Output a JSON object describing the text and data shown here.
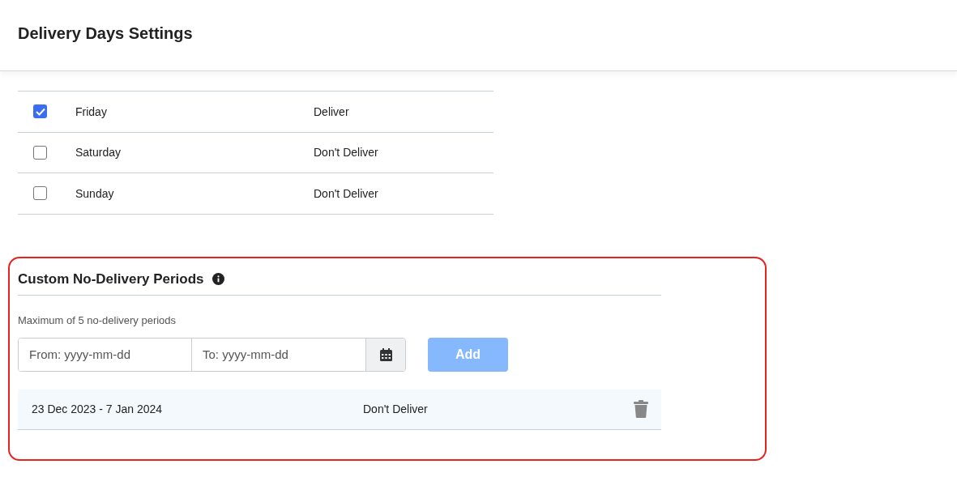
{
  "header": {
    "title": "Delivery Days Settings"
  },
  "days": [
    {
      "day": "Friday",
      "status": "Deliver",
      "checked": true
    },
    {
      "day": "Saturday",
      "status": "Don't Deliver",
      "checked": false
    },
    {
      "day": "Sunday",
      "status": "Don't Deliver",
      "checked": false
    }
  ],
  "custom_periods": {
    "title": "Custom No-Delivery Periods",
    "hint": "Maximum of 5 no-delivery periods",
    "from": {
      "placeholder": "From: yyyy-mm-dd"
    },
    "to": {
      "placeholder": "To: yyyy-mm-dd"
    },
    "add_button": {
      "label": "Add",
      "disabled": true
    },
    "periods": [
      {
        "range": "23 Dec 2023 - 7 Jan 2024",
        "status": "Don't Deliver"
      }
    ]
  }
}
